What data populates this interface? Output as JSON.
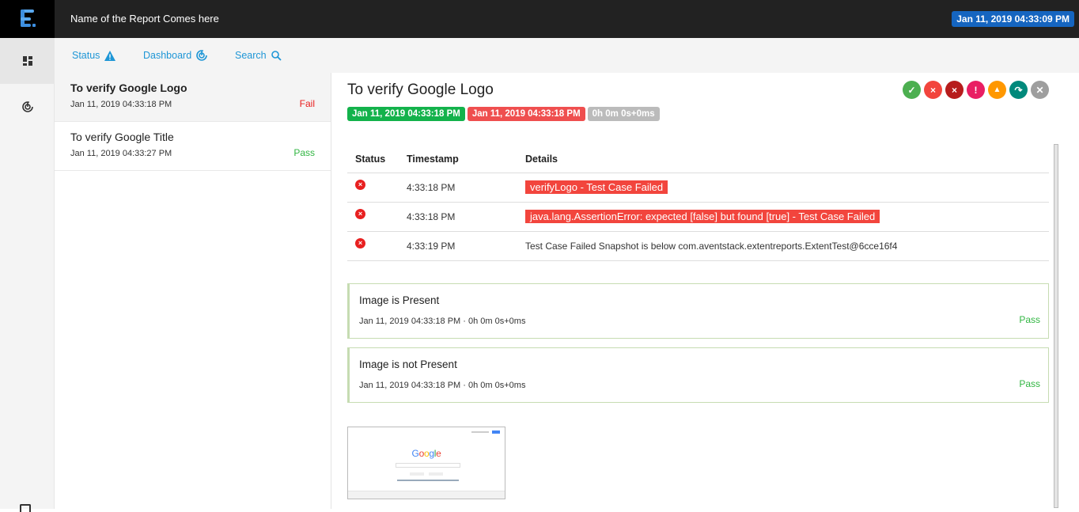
{
  "header": {
    "report_name": "Name of the Report Comes here",
    "date": "Jan 11, 2019 04:33:09 PM"
  },
  "leftnav": {
    "items": [
      {
        "icon": "dashboard-grid-icon",
        "active": true
      },
      {
        "icon": "radar-icon",
        "active": false
      }
    ]
  },
  "subnav": {
    "items": [
      {
        "label": "Status",
        "icon": "warning-icon"
      },
      {
        "label": "Dashboard",
        "icon": "radar-icon"
      },
      {
        "label": "Search",
        "icon": "search-icon"
      }
    ]
  },
  "tests": [
    {
      "name": "To verify Google Logo",
      "time": "Jan 11, 2019 04:33:18 PM",
      "status": "Fail",
      "status_color": "#e81c1c"
    },
    {
      "name": "To verify Google Title",
      "time": "Jan 11, 2019 04:33:27 PM",
      "status": "Pass",
      "status_color": "#32b643"
    }
  ],
  "detail": {
    "title": "To verify Google Logo",
    "start_time": "Jan 11, 2019 04:33:18 PM",
    "end_time": "Jan 11, 2019 04:33:18 PM",
    "duration": "0h 0m 0s+0ms",
    "filters": [
      {
        "name": "pass",
        "color": "#32b643",
        "glyph": "✓"
      },
      {
        "name": "fail",
        "color": "#f2453d",
        "glyph": "×"
      },
      {
        "name": "fatal",
        "color": "#b71c1c",
        "glyph": "×"
      },
      {
        "name": "error",
        "color": "#e91e63",
        "glyph": "!"
      },
      {
        "name": "warning",
        "color": "#ff9800",
        "glyph": "▲"
      },
      {
        "name": "skip",
        "color": "#00897b",
        "glyph": "↷"
      },
      {
        "name": "clear",
        "color": "#9e9e9e",
        "glyph": "✕"
      }
    ],
    "table": {
      "headers": [
        "Status",
        "Timestamp",
        "Details"
      ],
      "rows": [
        {
          "status": "fail",
          "timestamp": "4:33:18 PM",
          "details": "verifyLogo - Test Case Failed",
          "highlight": true
        },
        {
          "status": "fail",
          "timestamp": "4:33:18 PM",
          "details": "java.lang.AssertionError: expected [false] but found [true] - Test Case Failed",
          "highlight": true
        },
        {
          "status": "fail",
          "timestamp": "4:33:19 PM",
          "details": "Test Case Failed Snapshot is below com.aventstack.extentreports.ExtentTest@6cce16f4",
          "highlight": false
        }
      ]
    },
    "nodes": [
      {
        "name": "Image is Present",
        "meta": "Jan 11, 2019 04:33:18 PM · 0h 0m 0s+0ms",
        "status": "Pass"
      },
      {
        "name": "Image is not Present",
        "meta": "Jan 11, 2019 04:33:18 PM · 0h 0m 0s+0ms",
        "status": "Pass"
      }
    ],
    "snapshot": {
      "logo_text": "Google"
    }
  },
  "colors": {
    "accent": "#1e96d6",
    "pass": "#32b643",
    "fail": "#f2453d",
    "header_date_bg": "#1565c0",
    "duration_badge": "#bbbbbb"
  }
}
